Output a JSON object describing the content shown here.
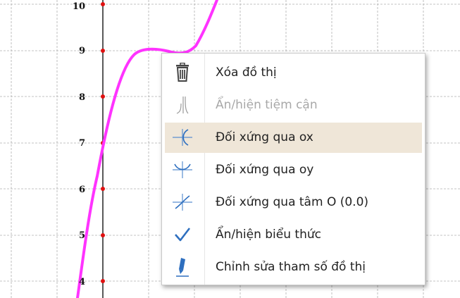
{
  "graph": {
    "y_ticks": [
      "10",
      "9",
      "8",
      "7",
      "6",
      "5",
      "4"
    ],
    "curve_color": "#ff33ff",
    "axis_point_color": "#e01010",
    "grid_color": "#b0b0b0"
  },
  "context_menu": {
    "items": [
      {
        "label": "Xóa đồ thị",
        "icon": "trash-icon",
        "enabled": true,
        "highlighted": false
      },
      {
        "label": "Ẩn/hiện tiệm cận",
        "icon": "asymptote-icon",
        "enabled": false,
        "highlighted": false
      },
      {
        "label": "Đối xứng qua ox",
        "icon": "reflect-ox-icon",
        "enabled": true,
        "highlighted": true
      },
      {
        "label": "Đối xứng qua oy",
        "icon": "reflect-oy-icon",
        "enabled": true,
        "highlighted": false
      },
      {
        "label": "Đối xứng qua tâm O (0.0)",
        "icon": "reflect-origin-icon",
        "enabled": true,
        "highlighted": false
      },
      {
        "label": "Ẩn/hiện biểu thức",
        "icon": "check-icon",
        "enabled": true,
        "highlighted": false
      },
      {
        "label": "Chỉnh sửa tham số đồ thị",
        "icon": "edit-pen-icon",
        "enabled": true,
        "highlighted": false
      }
    ],
    "highlight_color": "#efe6d8",
    "icon_color": "#3a7fc7"
  }
}
